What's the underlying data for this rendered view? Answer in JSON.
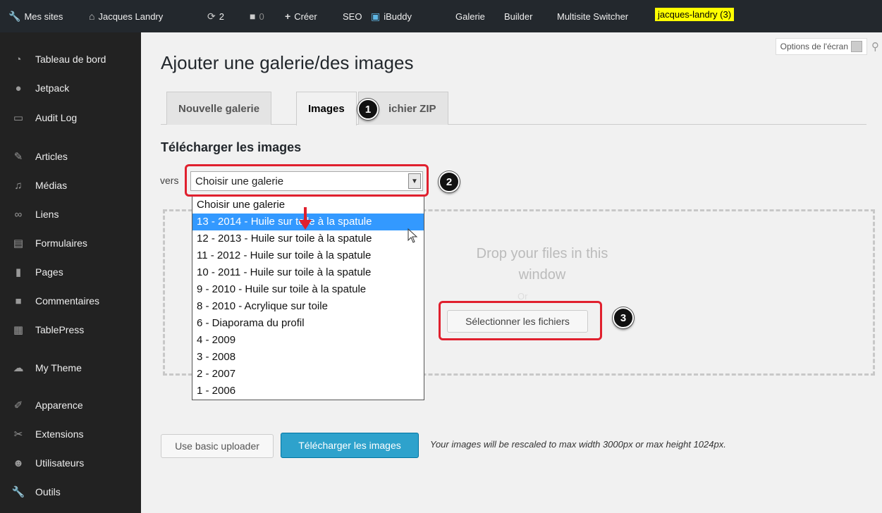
{
  "adminbar": {
    "my_sites": "Mes sites",
    "site_name": "Jacques Landry",
    "updates_count": "2",
    "comments_count": "0",
    "create": "Créer",
    "seo": "SEO",
    "ibuddy": "iBuddy",
    "gallery": "Galerie",
    "builder": "Builder",
    "multisite": "Multisite Switcher",
    "user_highlight": "jacques-landry (3)"
  },
  "sidebar": {
    "items": [
      {
        "label": "Tableau de bord",
        "icon": "dashboard-icon"
      },
      {
        "label": "Jetpack",
        "icon": "jetpack-icon"
      },
      {
        "label": "Audit Log",
        "icon": "audit-log-icon"
      },
      {
        "label": "Articles",
        "icon": "pushpin-icon"
      },
      {
        "label": "Médias",
        "icon": "media-icon"
      },
      {
        "label": "Liens",
        "icon": "link-icon"
      },
      {
        "label": "Formulaires",
        "icon": "forms-icon"
      },
      {
        "label": "Pages",
        "icon": "pages-icon"
      },
      {
        "label": "Commentaires",
        "icon": "comments-icon"
      },
      {
        "label": "TablePress",
        "icon": "table-icon"
      },
      {
        "label": "My Theme",
        "icon": "theme-icon"
      },
      {
        "label": "Apparence",
        "icon": "appearance-icon"
      },
      {
        "label": "Extensions",
        "icon": "plugins-icon"
      },
      {
        "label": "Utilisateurs",
        "icon": "users-icon"
      },
      {
        "label": "Outils",
        "icon": "tools-icon"
      }
    ]
  },
  "screen_options": "Options de l'écran",
  "page_title": "Ajouter une galerie/des images",
  "tabs": [
    {
      "label": "Nouvelle galerie",
      "active": false
    },
    {
      "label": "Images",
      "active": true
    },
    {
      "label": "ichier ZIP",
      "active": false
    }
  ],
  "upload": {
    "section_title": "Télécharger les images",
    "to_label": "vers",
    "select_value": "Choisir une galerie",
    "options": [
      "Choisir une galerie",
      "13 - 2014 - Huile sur toile à la spatule",
      "12 - 2013 - Huile sur toile à la spatule",
      "11 - 2012 - Huile sur toile à la spatule",
      "10 - 2011 - Huile sur toile à la spatule",
      "9 - 2010 - Huile sur toile à la spatule",
      "8 - 2010 - Acrylique sur toile",
      "6 - Diaporama du profil",
      "4 - 2009",
      "3 - 2008",
      "2 - 2007",
      "1 - 2006"
    ],
    "selected_index": 1,
    "drop_text_line1": "Drop your files in this",
    "drop_text_line2": "window",
    "drop_or": "Or",
    "select_files_button": "Sélectionner les fichiers",
    "basic_uploader_button": "Use basic uploader",
    "upload_button": "Télécharger les images",
    "rescale_note": "Your images will be rescaled to max width 3000px or max height 1024px."
  },
  "annotations": {
    "step1": "1",
    "step2": "2",
    "step3": "3"
  },
  "colors": {
    "accent": "#2ea2cc",
    "highlight": "#e0202e",
    "adminbar": "#23282d",
    "sidebar": "#222222"
  }
}
